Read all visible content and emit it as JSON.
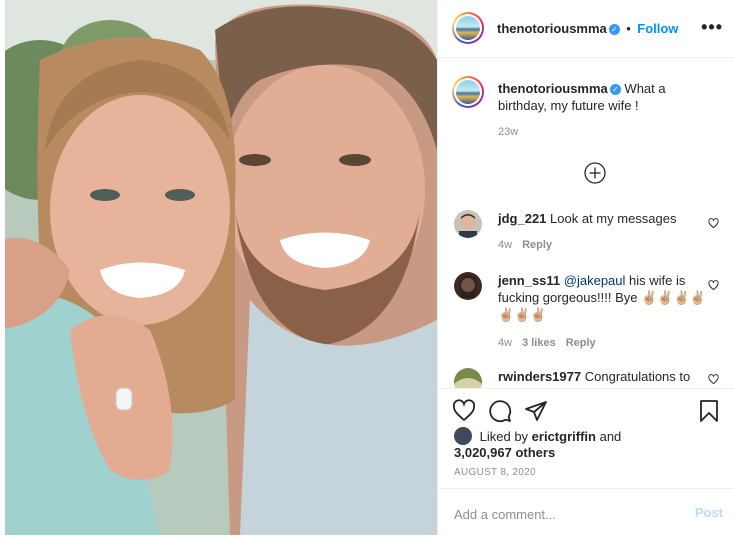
{
  "header": {
    "username": "thenotoriousmma",
    "verified_icon": "verified-badge-icon",
    "separator": "•",
    "follow_label": "Follow",
    "more_icon": "more-options-icon",
    "more_label": "•••"
  },
  "caption": {
    "username": "thenotoriousmma",
    "text": "What a birthday, my future wife !",
    "age": "23w"
  },
  "load_more_icon": "plus-circle-icon",
  "comments": [
    {
      "username": "jdg_221",
      "text": "Look at my messages",
      "age": "4w",
      "likes": "",
      "reply": "Reply"
    },
    {
      "username": "jenn_ss11",
      "mention": "@jakepaul",
      "text": "his wife is fucking gorgeous!!!! Bye ✌🏼✌🏼✌🏼✌🏼✌🏼✌🏼✌🏼",
      "age": "4w",
      "likes": "3 likes",
      "reply": "Reply"
    },
    {
      "username": "rwinders1977",
      "text": "Congratulations to",
      "age": "",
      "likes": "",
      "reply": ""
    }
  ],
  "actions": {
    "like_icon": "heart-icon",
    "comment_icon": "comment-icon",
    "share_icon": "share-icon",
    "save_icon": "bookmark-icon"
  },
  "likes": {
    "prefix": "Liked by",
    "user": "erictgriffin",
    "joiner": "and",
    "count": "3,020,967 others"
  },
  "date": "AUGUST 8, 2020",
  "add_comment": {
    "placeholder": "Add a comment...",
    "post_label": "Post"
  },
  "colors": {
    "accent": "#0095f6",
    "verified": "#3897f0",
    "post_disabled": "#b2dffc",
    "muted": "#8e8e8e"
  }
}
